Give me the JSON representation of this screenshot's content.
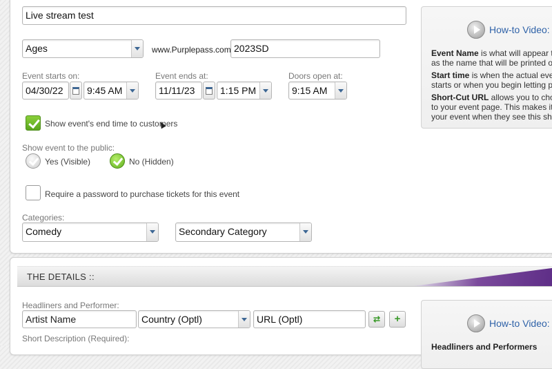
{
  "event": {
    "name_value": "Live stream test",
    "age_select": "Ages",
    "url_prefix": "www.Purplepass.com/",
    "url_value": "2023SD"
  },
  "dates": {
    "starts_label": "Event starts on:",
    "start_date": "04/30/22",
    "start_time": "9:45 AM",
    "ends_label": "Event ends at:",
    "end_date": "11/11/23",
    "end_time": "1:15 PM",
    "doors_label": "Doors open at:",
    "doors_time": "9:15 AM"
  },
  "options": {
    "show_end_time_label": "Show event's end time to customers",
    "show_end_time_checked": true,
    "public_label": "Show event to the public:",
    "public_yes_label": "Yes (Visible)",
    "public_no_label": "No (Hidden)",
    "public_selected": "no",
    "password_label": "Require a password to purchase tickets for this event",
    "password_checked": false
  },
  "categories": {
    "label": "Categories:",
    "primary": "Comedy",
    "secondary": "Secondary Category"
  },
  "help_top": {
    "title": "How-to Video:",
    "lines": [
      {
        "bold": "Event Name",
        "text": " is what will appear th"
      },
      {
        "bold": "",
        "text": "as the name that will be printed o"
      },
      {
        "bold": "Start time",
        "text": " is when the actual even"
      },
      {
        "bold": "",
        "text": "starts or when you begin letting pe"
      },
      {
        "bold": "Short-Cut URL",
        "text": " allows you to choo"
      },
      {
        "bold": "",
        "text": "to your event page. This makes it"
      },
      {
        "bold": "",
        "text": "your event when they see this sho"
      }
    ]
  },
  "details": {
    "section_title": "THE DETAILS ::",
    "headliners_label": "Headliners and Performer:",
    "artist_placeholder": "Artist Name",
    "country_placeholder": "Country (Optl)",
    "url_placeholder": "URL (Optl)",
    "short_desc_label": "Short Description (Required):",
    "help_title": "How-to Video:",
    "help_partial": "Headliners and Performers"
  },
  "colors": {
    "check_green": "#5aa51e",
    "link_blue": "#2f62a8",
    "brand_purple": "#5a2a84"
  }
}
